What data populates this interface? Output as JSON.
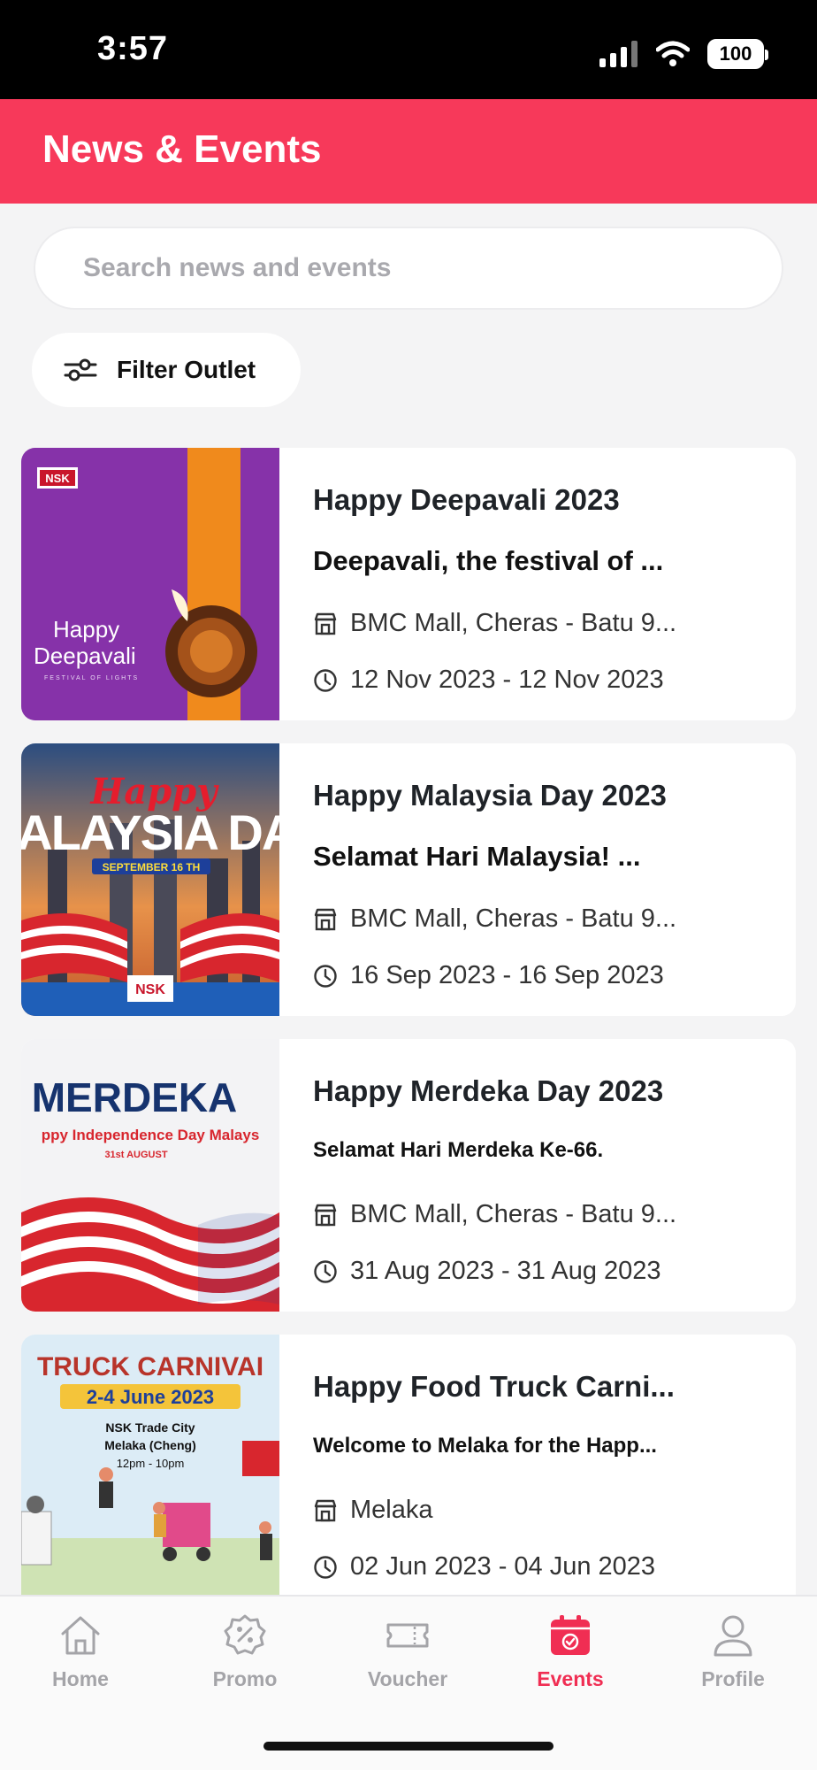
{
  "status_bar": {
    "time": "3:57",
    "battery": "100"
  },
  "header": {
    "title": "News & Events"
  },
  "search": {
    "placeholder": "Search news and events"
  },
  "filter": {
    "label": "Filter Outlet"
  },
  "events": [
    {
      "title": "Happy Deepavali 2023",
      "description": "Deepavali, the festival of ...",
      "outlet": "BMC Mall, Cheras - Batu 9...",
      "date_range": "12 Nov 2023 - 12 Nov 2023",
      "image": {
        "logo": "NSK",
        "line1": "Happy",
        "line2": "Deepavali",
        "line3": "FESTIVAL OF LIGHTS"
      }
    },
    {
      "title": "Happy Malaysia Day 2023",
      "description": "Selamat Hari Malaysia! ...",
      "outlet": "BMC Mall, Cheras - Batu 9...",
      "date_range": "16 Sep 2023 - 16 Sep 2023",
      "image": {
        "script": "Happy",
        "headline": "IALAYSIA DA",
        "ribbon": "SEPTEMBER 16 TH",
        "logo": "NSK"
      }
    },
    {
      "title": "Happy Merdeka Day 2023",
      "description": "Selamat Hari Merdeka Ke-66.",
      "outlet": "BMC Mall, Cheras - Batu 9...",
      "date_range": "31 Aug 2023 - 31 Aug 2023",
      "image": {
        "headline": "MERDEKA",
        "subline": "ppy Independence Day Malays",
        "date": "31st AUGUST"
      }
    },
    {
      "title": "Happy Food Truck Carni...",
      "description": "Welcome to Melaka for the Happ...",
      "outlet": "Melaka",
      "date_range": "02 Jun 2023 - 04 Jun 2023",
      "image": {
        "headline": "TRUCK CARNIVAI",
        "dates": "2-4 June 2023",
        "venue1": "NSK Trade City",
        "venue2": "Melaka (Cheng)",
        "hours": "12pm - 10pm"
      }
    }
  ],
  "nav": {
    "home": "Home",
    "promo": "Promo",
    "voucher": "Voucher",
    "events": "Events",
    "profile": "Profile"
  },
  "colors": {
    "brand": "#f7395a",
    "active_nav": "#f02e53"
  }
}
